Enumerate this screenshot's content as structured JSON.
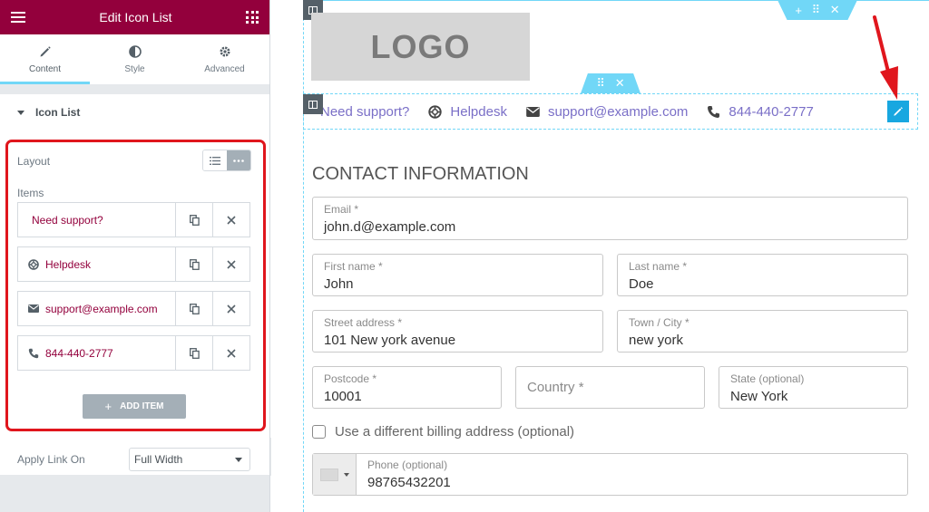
{
  "panel": {
    "title": "Edit Icon List",
    "tabs": [
      {
        "label": "Content",
        "icon": "pencil-icon",
        "active": true
      },
      {
        "label": "Style",
        "icon": "half-circle-icon",
        "active": false
      },
      {
        "label": "Advanced",
        "icon": "gear-icon",
        "active": false
      }
    ],
    "section_title": "Icon List",
    "layout_label": "Layout",
    "items_label": "Items",
    "items": [
      {
        "label": "Need support?",
        "icon": ""
      },
      {
        "label": "Helpdesk",
        "icon": "lifebuoy-icon"
      },
      {
        "label": "support@example.com",
        "icon": "envelope-icon"
      },
      {
        "label": "844-440-2777",
        "icon": "phone-icon"
      }
    ],
    "add_item_label": "ADD ITEM",
    "apply_link_label": "Apply Link On",
    "apply_link_value": "Full Width",
    "accent_color": "#93003c"
  },
  "preview": {
    "logo_text": "LOGO",
    "iconlist": [
      {
        "label": "Need support?",
        "icon": ""
      },
      {
        "label": "Helpdesk",
        "icon": "lifebuoy-icon"
      },
      {
        "label": "support@example.com",
        "icon": "envelope-icon"
      },
      {
        "label": "844-440-2777",
        "icon": "phone-icon"
      }
    ],
    "contact_title": "CONTACT INFORMATION",
    "fields": {
      "email": {
        "label": "Email *",
        "value": "john.d@example.com"
      },
      "first_name": {
        "label": "First name *",
        "value": "John"
      },
      "last_name": {
        "label": "Last name *",
        "value": "Doe"
      },
      "street": {
        "label": "Street address *",
        "value": "101 New york avenue"
      },
      "city": {
        "label": "Town / City *",
        "value": "new york"
      },
      "postcode": {
        "label": "Postcode *",
        "value": "10001"
      },
      "country": {
        "placeholder": "Country *"
      },
      "state": {
        "label": "State (optional)",
        "value": "New York"
      },
      "phone": {
        "label": "Phone (optional)",
        "value": "98765432201"
      }
    },
    "billing_label": "Use a different billing address (optional)",
    "editor_accent": "#71d7f7",
    "link_color": "#7a6fc7"
  }
}
